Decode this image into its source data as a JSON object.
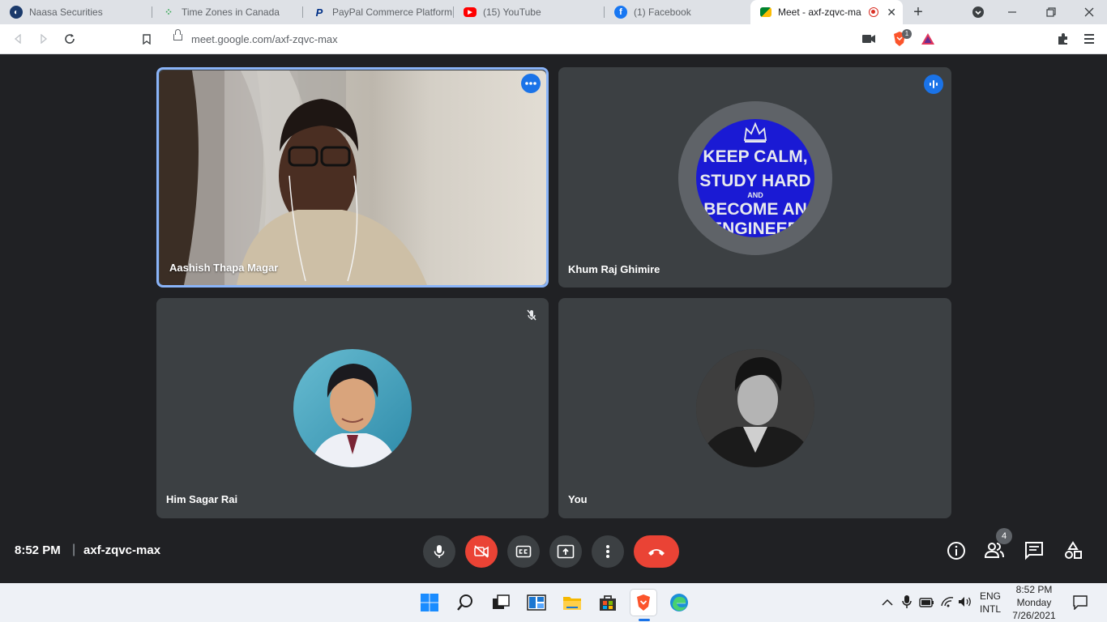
{
  "browser": {
    "tabs": [
      {
        "label": "Naasa Securities",
        "icon": "naasa-icon"
      },
      {
        "label": "Time Zones in Canada",
        "icon": "google-sheets-dots-icon"
      },
      {
        "label": "PayPal Commerce Platform",
        "icon": "paypal-icon"
      },
      {
        "label": "(15) YouTube",
        "icon": "youtube-icon"
      },
      {
        "label": "(1) Facebook",
        "icon": "facebook-icon"
      },
      {
        "label": "Meet - axf-zqvc-ma",
        "icon": "google-meet-icon",
        "active": true
      }
    ],
    "url": "meet.google.com/axf-zqvc-max",
    "brave_shield_count": "1"
  },
  "meet": {
    "participants": [
      {
        "name": "Aashish Thapa Magar",
        "state": "camera-on",
        "badge": "more-options"
      },
      {
        "name": "Khum Raj Ghimire",
        "state": "speaking",
        "badge": "audio-level",
        "avatar_text": [
          "KEEP CALM,",
          "STUDY HARD",
          "AND",
          "BECOME AN",
          "ENGINEER"
        ]
      },
      {
        "name": "Him Sagar Rai",
        "state": "muted",
        "badge": "mic-off"
      },
      {
        "name": "You",
        "state": "camera-off"
      }
    ],
    "bottom_bar": {
      "time": "8:52 PM",
      "separator": "|",
      "meeting_code": "axf-zqvc-max",
      "people_count": "4"
    },
    "colors": {
      "background": "#202124",
      "tile": "#3c4043",
      "accent_blue": "#1a73e8",
      "danger_red": "#ea4335"
    }
  },
  "taskbar": {
    "language_line1": "ENG",
    "language_line2": "INTL",
    "clock_time": "8:52 PM",
    "clock_day": "Monday",
    "clock_date": "7/26/2021"
  }
}
